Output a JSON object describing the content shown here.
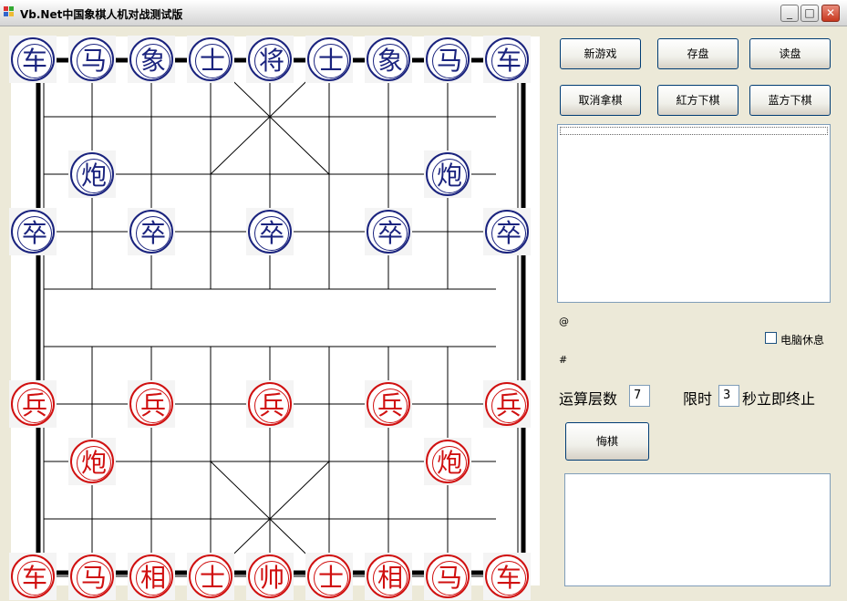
{
  "window": {
    "title": "Vb.Net中国象棋人机对战测试版",
    "minimize": "_",
    "maximize": "□",
    "close": "✕"
  },
  "toolbar": {
    "new_game": "新游戏",
    "save": "存盘",
    "load": "读盘",
    "cancel_pick": "取消拿棋",
    "red_move": "紅方下棋",
    "blue_move": "蓝方下棋",
    "undo": "悔棋"
  },
  "status": {
    "at_label": "@",
    "hash_label": "#",
    "computer_rest": "电脑休息",
    "computer_rest_checked": false
  },
  "settings": {
    "depth_label": "运算层数",
    "depth_value": "7",
    "time_label": "限时",
    "time_value": "3",
    "time_suffix": "秒立即终止"
  },
  "board": {
    "pieces": [
      {
        "char": "车",
        "side": "blue",
        "col": 0,
        "row": 0
      },
      {
        "char": "马",
        "side": "blue",
        "col": 1,
        "row": 0
      },
      {
        "char": "象",
        "side": "blue",
        "col": 2,
        "row": 0
      },
      {
        "char": "士",
        "side": "blue",
        "col": 3,
        "row": 0
      },
      {
        "char": "将",
        "side": "blue",
        "col": 4,
        "row": 0
      },
      {
        "char": "士",
        "side": "blue",
        "col": 5,
        "row": 0
      },
      {
        "char": "象",
        "side": "blue",
        "col": 6,
        "row": 0
      },
      {
        "char": "马",
        "side": "blue",
        "col": 7,
        "row": 0
      },
      {
        "char": "车",
        "side": "blue",
        "col": 8,
        "row": 0
      },
      {
        "char": "炮",
        "side": "blue",
        "col": 1,
        "row": 2
      },
      {
        "char": "炮",
        "side": "blue",
        "col": 7,
        "row": 2
      },
      {
        "char": "卒",
        "side": "blue",
        "col": 0,
        "row": 3
      },
      {
        "char": "卒",
        "side": "blue",
        "col": 2,
        "row": 3
      },
      {
        "char": "卒",
        "side": "blue",
        "col": 4,
        "row": 3
      },
      {
        "char": "卒",
        "side": "blue",
        "col": 6,
        "row": 3
      },
      {
        "char": "卒",
        "side": "blue",
        "col": 8,
        "row": 3
      },
      {
        "char": "兵",
        "side": "red",
        "col": 0,
        "row": 6
      },
      {
        "char": "兵",
        "side": "red",
        "col": 2,
        "row": 6
      },
      {
        "char": "兵",
        "side": "red",
        "col": 4,
        "row": 6
      },
      {
        "char": "兵",
        "side": "red",
        "col": 6,
        "row": 6
      },
      {
        "char": "兵",
        "side": "red",
        "col": 8,
        "row": 6
      },
      {
        "char": "炮",
        "side": "red",
        "col": 1,
        "row": 7
      },
      {
        "char": "炮",
        "side": "red",
        "col": 7,
        "row": 7
      },
      {
        "char": "车",
        "side": "red",
        "col": 0,
        "row": 9
      },
      {
        "char": "马",
        "side": "red",
        "col": 1,
        "row": 9
      },
      {
        "char": "相",
        "side": "red",
        "col": 2,
        "row": 9
      },
      {
        "char": "士",
        "side": "red",
        "col": 3,
        "row": 9
      },
      {
        "char": "帅",
        "side": "red",
        "col": 4,
        "row": 9
      },
      {
        "char": "士",
        "side": "red",
        "col": 5,
        "row": 9
      },
      {
        "char": "相",
        "side": "red",
        "col": 6,
        "row": 9
      },
      {
        "char": "马",
        "side": "red",
        "col": 7,
        "row": 9
      },
      {
        "char": "车",
        "side": "red",
        "col": 8,
        "row": 9
      }
    ]
  }
}
